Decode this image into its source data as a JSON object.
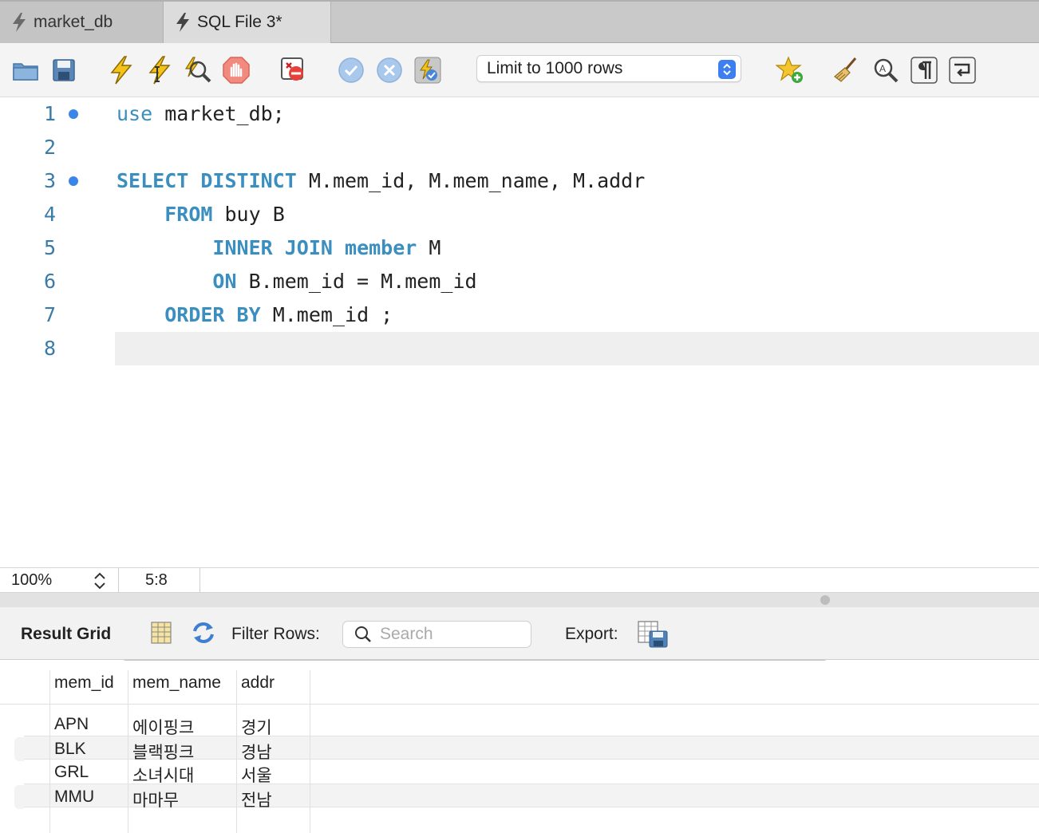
{
  "tabs": [
    {
      "label": "market_db",
      "active": false
    },
    {
      "label": "SQL File 3*",
      "active": true
    }
  ],
  "toolbar": {
    "limit_select": "Limit to 1000 rows",
    "icons": [
      "open-file-icon",
      "save-icon",
      "execute-icon",
      "execute-statement-icon",
      "explain-icon",
      "stop-icon",
      "toggle-error-icon",
      "commit-icon",
      "rollback-icon",
      "autocommit-icon",
      "favorite-add-icon",
      "beautify-icon",
      "find-icon",
      "invisible-chars-icon",
      "wrap-lines-icon"
    ]
  },
  "editor": {
    "line_numbers": [
      "1",
      "2",
      "3",
      "4",
      "5",
      "6",
      "7",
      "8"
    ],
    "lines": [
      {
        "indent": "",
        "tokens": [
          {
            "t": "use",
            "k": "kw2"
          },
          {
            "t": " market_db;",
            "k": ""
          }
        ]
      },
      {
        "indent": "",
        "tokens": []
      },
      {
        "indent": "",
        "tokens": [
          {
            "t": "SELECT",
            "k": "kw"
          },
          {
            "t": " ",
            "k": ""
          },
          {
            "t": "DISTINCT",
            "k": "kw"
          },
          {
            "t": " M.mem_id, M.mem_name, M.addr",
            "k": ""
          }
        ]
      },
      {
        "indent": "    ",
        "tokens": [
          {
            "t": "FROM",
            "k": "kw"
          },
          {
            "t": " buy B",
            "k": ""
          }
        ]
      },
      {
        "indent": "        ",
        "tokens": [
          {
            "t": "INNER",
            "k": "kw"
          },
          {
            "t": " ",
            "k": ""
          },
          {
            "t": "JOIN",
            "k": "kw"
          },
          {
            "t": " ",
            "k": ""
          },
          {
            "t": "member",
            "k": "kw"
          },
          {
            "t": " M",
            "k": ""
          }
        ]
      },
      {
        "indent": "        ",
        "tokens": [
          {
            "t": "ON",
            "k": "kw"
          },
          {
            "t": " B.mem_id = M.mem_id",
            "k": ""
          }
        ]
      },
      {
        "indent": "    ",
        "tokens": [
          {
            "t": "ORDER",
            "k": "kw"
          },
          {
            "t": " ",
            "k": ""
          },
          {
            "t": "BY",
            "k": "kw"
          },
          {
            "t": " M.mem_id ;",
            "k": ""
          }
        ]
      },
      {
        "indent": "",
        "tokens": []
      }
    ],
    "statement_markers": [
      1,
      3
    ]
  },
  "status": {
    "zoom": "100%",
    "cursor_position": "5:8"
  },
  "result": {
    "title": "Result Grid",
    "filter_label": "Filter Rows:",
    "search_placeholder": "Search",
    "export_label": "Export:",
    "columns": [
      "mem_id",
      "mem_name",
      "addr"
    ],
    "rows": [
      [
        "APN",
        "에이핑크",
        "경기"
      ],
      [
        "BLK",
        "블랙핑크",
        "경남"
      ],
      [
        "GRL",
        "소녀시대",
        "서울"
      ],
      [
        "MMU",
        "마마무",
        "전남"
      ]
    ]
  },
  "colors": {
    "keyword": "#3a8fc0",
    "line_number": "#3a7ca8",
    "marker": "#3a86e8",
    "stepper": "#3d7ff0"
  }
}
